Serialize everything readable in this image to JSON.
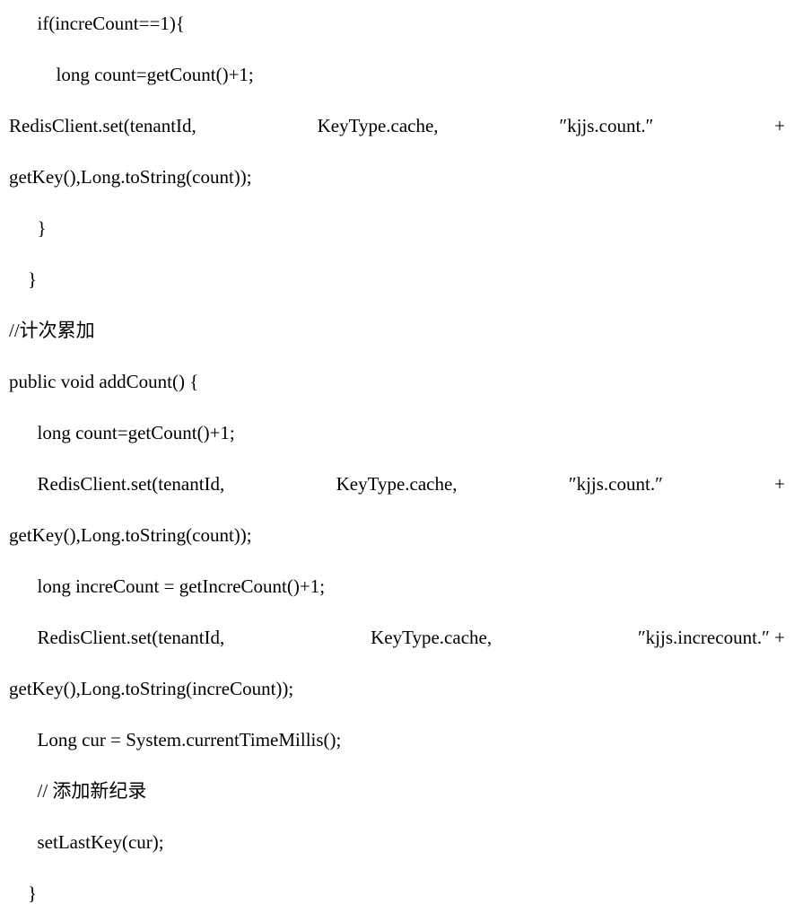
{
  "code": {
    "l1": "      if(increCount==1){",
    "l2": "          long count=getCount()+1;",
    "l3a": "RedisClient.set(tenantId,",
    "l3b": "KeyType.cache,",
    "l3c": "″kjjs.count.″",
    "l3d": "+",
    "l4": "getKey(),Long.toString(count));",
    "l5": "      }",
    "l6": "    }",
    "l7": "//计次累加",
    "l8": "public void addCount() {",
    "l9": "      long count=getCount()+1;",
    "l10a": "      RedisClient.set(tenantId,",
    "l10b": "KeyType.cache,",
    "l10c": "″kjjs.count.″",
    "l10d": "+",
    "l11": "getKey(),Long.toString(count));",
    "l12": "      long increCount = getIncreCount()+1;",
    "l13a": "      RedisClient.set(tenantId,",
    "l13b": "KeyType.cache,",
    "l13c": "″kjjs.increcount.″ +",
    "l14": "getKey(),Long.toString(increCount));",
    "l15": "      Long cur = System.currentTimeMillis();",
    "l16": "      // 添加新纪录",
    "l17": "      setLastKey(cur);",
    "l18": "    }"
  }
}
